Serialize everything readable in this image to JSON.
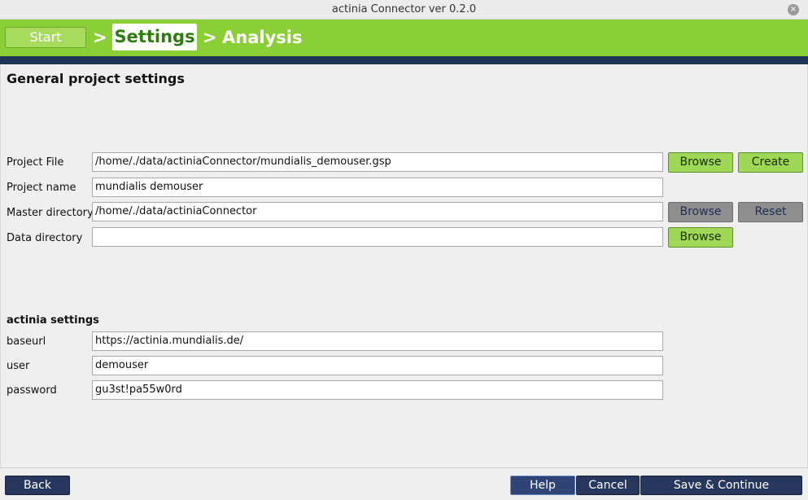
{
  "window": {
    "title": "actinia Connector ver 0.2.0",
    "close_icon": "close-icon"
  },
  "wizard": {
    "steps": [
      {
        "label": "Start",
        "state": "done"
      },
      {
        "label": "Settings",
        "state": "active"
      },
      {
        "label": "Analysis",
        "state": "pending"
      }
    ],
    "separator": ">"
  },
  "general": {
    "title": "General project settings",
    "project_file": {
      "label": "Project File",
      "value": "/home/./data/actiniaConnector/mundialis_demouser.gsp",
      "browse": "Browse",
      "create": "Create"
    },
    "project_name": {
      "label": "Project name",
      "value": "mundialis demouser"
    },
    "master_directory": {
      "label": "Master directory",
      "value": "/home/./data/actiniaConnector",
      "browse": "Browse",
      "reset": "Reset"
    },
    "data_directory": {
      "label": "Data directory",
      "value": "",
      "browse": "Browse"
    }
  },
  "actinia": {
    "title": "actinia settings",
    "baseurl": {
      "label": "baseurl",
      "value": "https://actinia.mundialis.de/"
    },
    "user": {
      "label": "user",
      "value": "demouser"
    },
    "password": {
      "label": "password",
      "value": "gu3st!pa55w0rd"
    }
  },
  "footer": {
    "back": "Back",
    "help": "Help",
    "cancel": "Cancel",
    "save_continue": "Save & Continue"
  },
  "colors": {
    "wizard_green": "#8bcf36",
    "navy": "#1f3355",
    "button_green": "#9fd757",
    "button_navy": "#27375e"
  }
}
